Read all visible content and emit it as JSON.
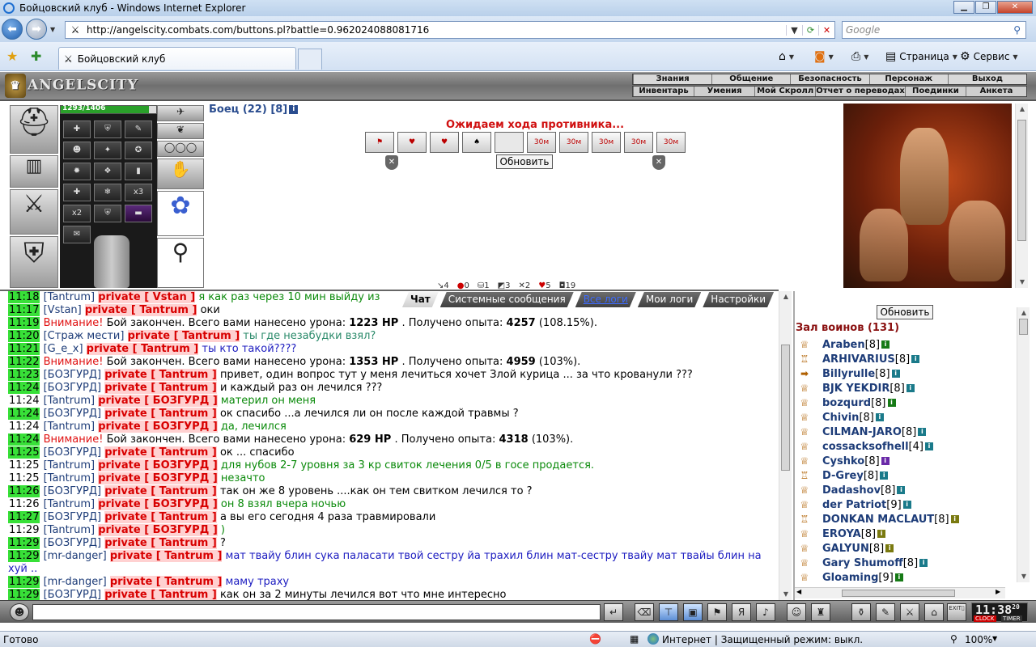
{
  "window": {
    "title": "Бойцовский клуб - Windows Internet Explorer"
  },
  "browser": {
    "url": "http://angelscity.combats.com/buttons.pl?battle=0.962024088081716",
    "search_placeholder": "Google",
    "tab_title": "Бойцовский клуб",
    "cmd_page": "Страница",
    "cmd_tools": "Сервис"
  },
  "game": {
    "logo": "ANGELSCITY",
    "menu_top": [
      "Знания",
      "Общение",
      "Безопасность",
      "Персонаж",
      "Выход"
    ],
    "menu_bottom": [
      "Инвентарь",
      "Умения",
      "Мой Скролл",
      "Отчет о переводах",
      "Поединки",
      "Анкета"
    ],
    "hp_text": "1293/1406",
    "hp_fraction": 0.92,
    "fighter_name": "Боец (22) [8]",
    "waiting_text": "Ожидаем хода противника...",
    "refresh_label": "Обновить",
    "action_timers": [
      "30м",
      "30м",
      "30м",
      "30м",
      "30м"
    ],
    "stats": [
      "4",
      "0",
      "1",
      "3",
      "2",
      "5",
      "19"
    ],
    "inv_multipliers": [
      "x3",
      "x2"
    ]
  },
  "chat": {
    "tabs": [
      "Чат",
      "Системные сообщения",
      "Все логи",
      "Мои логи",
      "Настройки"
    ],
    "lines": [
      {
        "time": "11:18",
        "parts": [
          [
            "nk",
            "[Tantrum]"
          ],
          [
            "pv",
            "private [ Vstan ]"
          ],
          [
            "m-green",
            "я как раз через 10 мин выйду из"
          ]
        ]
      },
      {
        "time": "11:17",
        "parts": [
          [
            "nk",
            "[Vstan]"
          ],
          [
            "pv",
            "private [ Tantrum ]"
          ],
          [
            "plain",
            "оки"
          ]
        ]
      },
      {
        "time": "11:19",
        "parts": [
          [
            "att",
            "Внимание!"
          ],
          [
            "plain",
            "Бой закончен. Всего вами нанесено урона:"
          ],
          [
            "b",
            "1223 HP"
          ],
          [
            "plain",
            ". Получено опыта:"
          ],
          [
            "b",
            "4257"
          ],
          [
            "plain",
            "(108.15%)."
          ]
        ]
      },
      {
        "time": "11:20",
        "parts": [
          [
            "nk",
            "[Страж мести]"
          ],
          [
            "pv",
            "private [ Tantrum ]"
          ],
          [
            "m-teal",
            "ты где незабудки взял?"
          ]
        ]
      },
      {
        "time": "11:21",
        "parts": [
          [
            "nk",
            "[G_e_x]"
          ],
          [
            "pv",
            "private [ Tantrum ]"
          ],
          [
            "m-blue",
            "ты кто такой????"
          ]
        ]
      },
      {
        "time": "11:22",
        "parts": [
          [
            "att",
            "Внимание!"
          ],
          [
            "plain",
            "Бой закончен. Всего вами нанесено урона:"
          ],
          [
            "b",
            "1353 HP"
          ],
          [
            "plain",
            ". Получено опыта:"
          ],
          [
            "b",
            "4959"
          ],
          [
            "plain",
            "(103%)."
          ]
        ]
      },
      {
        "time": "11:23",
        "parts": [
          [
            "nk",
            "[БОЗГУРД]"
          ],
          [
            "pv",
            "private [ Tantrum ]"
          ],
          [
            "plain",
            "привет, один вопрос тут у меня лечиться хочет Злой курица ... за что крованули ???"
          ]
        ]
      },
      {
        "time": "11:24",
        "parts": [
          [
            "nk",
            "[БОЗГУРД]"
          ],
          [
            "pv",
            "private [ Tantrum ]"
          ],
          [
            "plain",
            "и каждый раз он лечился ???"
          ]
        ]
      },
      {
        "time": "11:24",
        "white": true,
        "parts": [
          [
            "nk",
            "[Tantrum]"
          ],
          [
            "pv",
            "private [ БОЗГУРД ]"
          ],
          [
            "m-green",
            "материл он меня"
          ]
        ]
      },
      {
        "time": "11:24",
        "parts": [
          [
            "nk",
            "[БОЗГУРД]"
          ],
          [
            "pv",
            "private [ Tantrum ]"
          ],
          [
            "plain",
            "ок спасибо ...а лечился ли он после каждой травмы ?"
          ]
        ]
      },
      {
        "time": "11:24",
        "white": true,
        "parts": [
          [
            "nk",
            "[Tantrum]"
          ],
          [
            "pv",
            "private [ БОЗГУРД ]"
          ],
          [
            "m-green",
            "да, лечился"
          ]
        ]
      },
      {
        "time": "11:24",
        "parts": [
          [
            "att",
            "Внимание!"
          ],
          [
            "plain",
            "Бой закончен. Всего вами нанесено урона:"
          ],
          [
            "b",
            "629 HP"
          ],
          [
            "plain",
            ". Получено опыта:"
          ],
          [
            "b",
            "4318"
          ],
          [
            "plain",
            "(103%)."
          ]
        ]
      },
      {
        "time": "11:25",
        "parts": [
          [
            "nk",
            "[БОЗГУРД]"
          ],
          [
            "pv",
            "private [ Tantrum ]"
          ],
          [
            "plain",
            "ок ... спасибо"
          ]
        ]
      },
      {
        "time": "11:25",
        "white": true,
        "parts": [
          [
            "nk",
            "[Tantrum]"
          ],
          [
            "pv",
            "private [ БОЗГУРД ]"
          ],
          [
            "m-green",
            "для нубов 2-7 уровня за 3 кр свиток лечения 0/5 в госе продается."
          ]
        ]
      },
      {
        "time": "11:25",
        "white": true,
        "parts": [
          [
            "nk",
            "[Tantrum]"
          ],
          [
            "pv",
            "private [ БОЗГУРД ]"
          ],
          [
            "m-green",
            "незачто"
          ]
        ]
      },
      {
        "time": "11:26",
        "parts": [
          [
            "nk",
            "[БОЗГУРД]"
          ],
          [
            "pv",
            "private [ Tantrum ]"
          ],
          [
            "plain",
            "так он же 8 уровень ....как он тем свитком лечился то ?"
          ]
        ]
      },
      {
        "time": "11:26",
        "white": true,
        "parts": [
          [
            "nk",
            "[Tantrum]"
          ],
          [
            "pv",
            "private [ БОЗГУРД ]"
          ],
          [
            "m-green",
            "он 8 взял вчера ночью"
          ]
        ]
      },
      {
        "time": "11:27",
        "parts": [
          [
            "nk",
            "[БОЗГУРД]"
          ],
          [
            "pv",
            "private [ Tantrum ]"
          ],
          [
            "plain",
            "а вы его сегодня 4 раза травмировали"
          ]
        ]
      },
      {
        "time": "11:29",
        "white": true,
        "parts": [
          [
            "nk",
            "[Tantrum]"
          ],
          [
            "pv",
            "private [ БОЗГУРД ]"
          ],
          [
            "m-green",
            ")"
          ]
        ]
      },
      {
        "time": "11:29",
        "parts": [
          [
            "nk",
            "[БОЗГУРД]"
          ],
          [
            "pv",
            "private [ Tantrum ]"
          ],
          [
            "plain",
            "?"
          ]
        ]
      },
      {
        "time": "11:29",
        "wrap": true,
        "parts": [
          [
            "nk",
            "[mr-danger]"
          ],
          [
            "pv",
            "private [ Tantrum ]"
          ],
          [
            "m-blue",
            "мат твайу блин сука паласати твой сестру йа трахил блин мат-сестру твайу мат твайы блин на хуй .."
          ]
        ]
      },
      {
        "time": "11:29",
        "parts": [
          [
            "nk",
            "[mr-danger]"
          ],
          [
            "pv",
            "private [ Tantrum ]"
          ],
          [
            "m-blue",
            "маму траху"
          ]
        ]
      },
      {
        "time": "11:29",
        "parts": [
          [
            "nk",
            "[БОЗГУРД]"
          ],
          [
            "pv",
            "private [ Tantrum ]"
          ],
          [
            "plain",
            "как он за 2 минуты лечился вот что мне интересно"
          ]
        ]
      }
    ]
  },
  "hall": {
    "refresh_label": "Обновить",
    "title": "Зал воинов (131)",
    "players": [
      {
        "name": "Araben",
        "level": "[8]",
        "info": "g"
      },
      {
        "name": "ARHIVARIUS",
        "level": "[8]",
        "info": "t"
      },
      {
        "name": "Billyrulle",
        "level": "[8]",
        "info": "t"
      },
      {
        "name": "BJK YEKDIR",
        "level": "[8]",
        "info": "t"
      },
      {
        "name": "bozqurd",
        "level": "[8]",
        "info": "g"
      },
      {
        "name": "Chivin",
        "level": "[8]",
        "info": "t"
      },
      {
        "name": "CILMAN-JARO",
        "level": "[8]",
        "info": "t"
      },
      {
        "name": "cossacksofhell",
        "level": "[4]",
        "info": "t"
      },
      {
        "name": "Cyshko",
        "level": "[8]",
        "info": "p"
      },
      {
        "name": "D-Grey",
        "level": "[8]",
        "info": "t"
      },
      {
        "name": "Dadashov",
        "level": "[8]",
        "info": "t"
      },
      {
        "name": "der Patriot",
        "level": "[9]",
        "info": "t"
      },
      {
        "name": "DONKAN MACLAUT",
        "level": "[8]",
        "info": "k"
      },
      {
        "name": "EROYA",
        "level": "[8]",
        "info": "k"
      },
      {
        "name": "GALYUN",
        "level": "[8]",
        "info": "k"
      },
      {
        "name": "Gary Shumoff",
        "level": "[8]",
        "info": "t"
      },
      {
        "name": "Gloaming",
        "level": "[9]",
        "info": "g"
      }
    ]
  },
  "clock": {
    "time": "11:38",
    "seconds": "20",
    "label_clock": "CLOCK",
    "label_timer": "TIMER"
  },
  "toolbar": {
    "exit_label": "EXIT"
  },
  "status": {
    "ready": "Готово",
    "zone": "Интернет | Защищенный режим: выкл.",
    "zoom": "100%"
  },
  "colors": {
    "time_highlight": "#38e038",
    "private_bg": "#ffd1d1",
    "private_fg": "#d80000",
    "nick": "#1d3c78"
  }
}
